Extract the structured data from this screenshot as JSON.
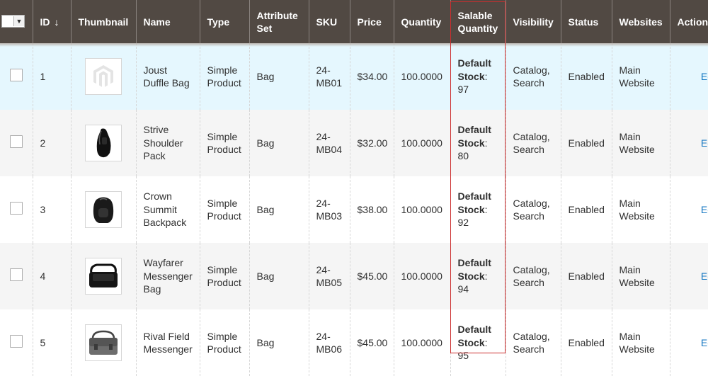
{
  "header": {
    "id": "ID",
    "id_sort": "↓",
    "thumbnail": "Thumbnail",
    "name": "Name",
    "type": "Type",
    "attribute_set": "Attribute Set",
    "sku": "SKU",
    "price": "Price",
    "quantity": "Quantity",
    "salable_quantity": "Salable Quantity",
    "visibility": "Visibility",
    "status": "Status",
    "websites": "Websites",
    "action": "Action"
  },
  "icons": {
    "mass_select_arrow": "chevron-down-icon",
    "sort": "arrow-down-icon"
  },
  "colors": {
    "header_bg": "#514943",
    "selected_row_bg": "#e5f7fe",
    "stripe_bg": "#f5f5f5",
    "link": "#1979c3",
    "highlight_border": "#cc2e2e"
  },
  "rows": [
    {
      "id": "1",
      "thumb": "magento-logo-placeholder",
      "name": "Joust Duffle Bag",
      "type": "Simple Product",
      "attribute_set": "Bag",
      "sku": "24-MB01",
      "price": "$34.00",
      "quantity": "100.0000",
      "stock_label": "Default Stock",
      "stock_qty": "97",
      "visibility": "Catalog, Search",
      "status": "Enabled",
      "websites": "Main Website",
      "action": "Edit"
    },
    {
      "id": "2",
      "thumb": "shoulder-pack",
      "name": "Strive Shoulder Pack",
      "type": "Simple Product",
      "attribute_set": "Bag",
      "sku": "24-MB04",
      "price": "$32.00",
      "quantity": "100.0000",
      "stock_label": "Default Stock",
      "stock_qty": "80",
      "visibility": "Catalog, Search",
      "status": "Enabled",
      "websites": "Main Website",
      "action": "Edit"
    },
    {
      "id": "3",
      "thumb": "backpack",
      "name": "Crown Summit Backpack",
      "type": "Simple Product",
      "attribute_set": "Bag",
      "sku": "24-MB03",
      "price": "$38.00",
      "quantity": "100.0000",
      "stock_label": "Default Stock",
      "stock_qty": "92",
      "visibility": "Catalog, Search",
      "status": "Enabled",
      "websites": "Main Website",
      "action": "Edit"
    },
    {
      "id": "4",
      "thumb": "messenger-bag",
      "name": "Wayfarer Messenger Bag",
      "type": "Simple Product",
      "attribute_set": "Bag",
      "sku": "24-MB05",
      "price": "$45.00",
      "quantity": "100.0000",
      "stock_label": "Default Stock",
      "stock_qty": "94",
      "visibility": "Catalog, Search",
      "status": "Enabled",
      "websites": "Main Website",
      "action": "Edit"
    },
    {
      "id": "5",
      "thumb": "field-messenger",
      "name": "Rival Field Messenger",
      "type": "Simple Product",
      "attribute_set": "Bag",
      "sku": "24-MB06",
      "price": "$45.00",
      "quantity": "100.0000",
      "stock_label": "Default Stock",
      "stock_qty": "95",
      "visibility": "Catalog, Search",
      "status": "Enabled",
      "websites": "Main Website",
      "action": "Edit"
    }
  ]
}
